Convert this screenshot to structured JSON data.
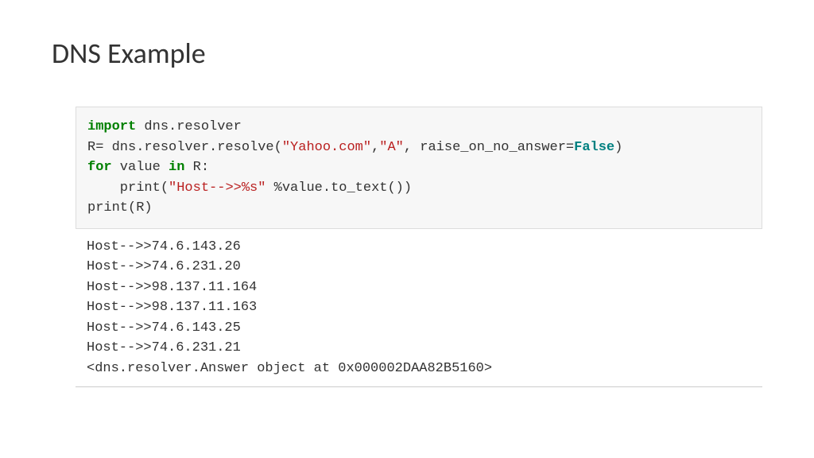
{
  "title": "DNS Example",
  "code": {
    "line1": {
      "import": "import",
      "module": " dns.resolver"
    },
    "line2": {
      "prefix": "R= dns.resolver.resolve(",
      "arg1": "\"Yahoo.com\"",
      "comma1": ",",
      "arg2": "\"A\"",
      "comma2": ", raise_on_no_answer=",
      "false": "False",
      "close": ")"
    },
    "line3": {
      "for": "for",
      "mid": " value ",
      "in": "in",
      "end": " R:"
    },
    "line4": {
      "indent": "    print(",
      "str": "\"Host-->>%s\"",
      "end": " %value.to_text())"
    },
    "line5": "print(R)"
  },
  "output": {
    "line1": "Host-->>74.6.143.26",
    "line2": "Host-->>74.6.231.20",
    "line3": "Host-->>98.137.11.164",
    "line4": "Host-->>98.137.11.163",
    "line5": "Host-->>74.6.143.25",
    "line6": "Host-->>74.6.231.21",
    "line7": "<dns.resolver.Answer object at 0x000002DAA82B5160>"
  }
}
